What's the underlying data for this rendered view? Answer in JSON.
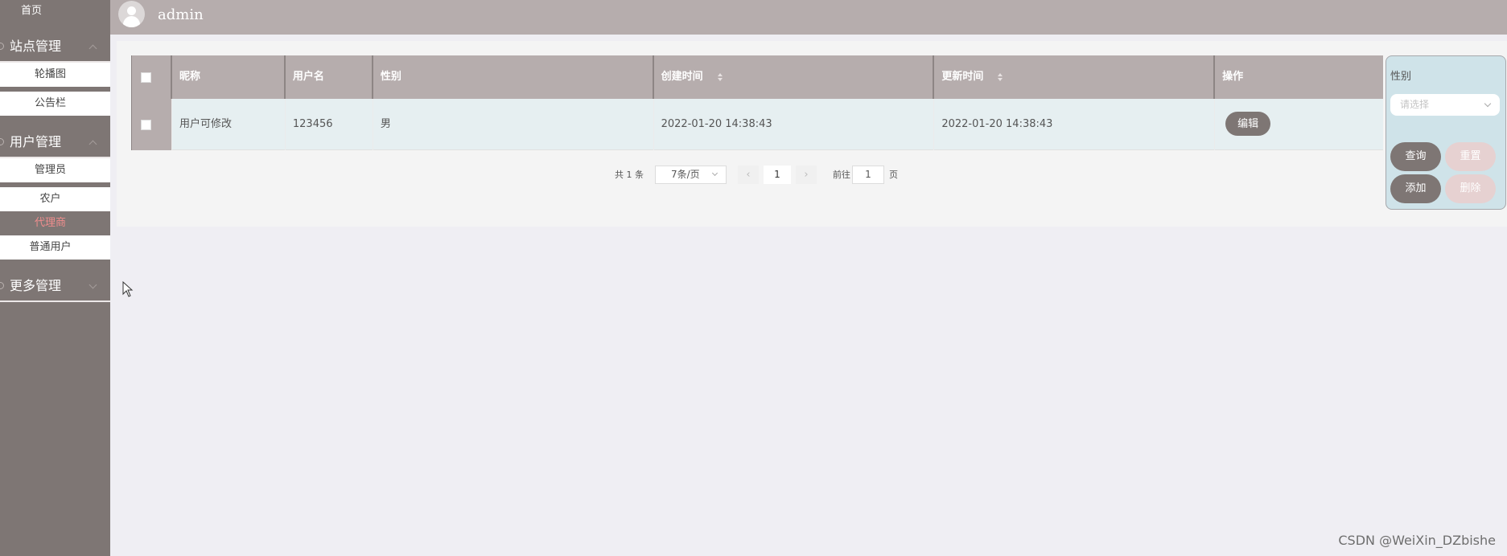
{
  "header": {
    "username": "admin"
  },
  "sidebar": {
    "home": "首页",
    "groups": [
      {
        "label": "站点管理",
        "items": [
          "轮播图",
          "公告栏"
        ]
      },
      {
        "label": "用户管理",
        "items": [
          "管理员",
          "农户",
          "代理商",
          "普通用户"
        ]
      },
      {
        "label": "更多管理",
        "items": []
      }
    ],
    "active_item": "代理商"
  },
  "table": {
    "columns": [
      "昵称",
      "用户名",
      "性别",
      "创建时间",
      "更新时间",
      "操作"
    ],
    "rows": [
      {
        "nickname": "用户可修改",
        "username": "123456",
        "gender": "男",
        "created": "2022-01-20 14:38:43",
        "updated": "2022-01-20 14:38:43",
        "action": "编辑"
      }
    ]
  },
  "pagination": {
    "total": "共 1 条",
    "page_size": "7条/页",
    "prev": "‹",
    "next": "›",
    "current": "1",
    "goto_label": "前往",
    "goto_value": "1",
    "page_suffix": "页"
  },
  "filter": {
    "label": "性别",
    "placeholder": "请选择",
    "query": "查询",
    "reset": "重置",
    "add": "添加",
    "delete": "删除"
  },
  "watermark": "CSDN @WeiXin_DZbishe",
  "colors": {
    "sidebar": "#7e7674",
    "header": "#b6adad",
    "accent_active": "#ef8d8d",
    "filter_panel": "#cfe3e9"
  }
}
